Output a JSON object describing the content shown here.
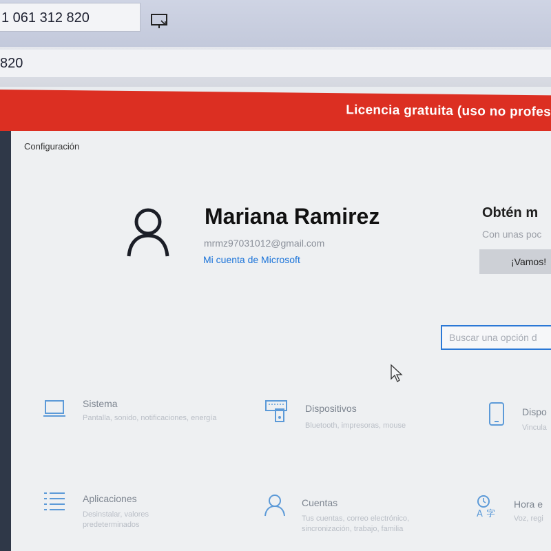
{
  "remote": {
    "id_value": "1 061 312 820",
    "address_value": "820"
  },
  "banner": {
    "text": "Licencia gratuita (uso no profes"
  },
  "settings": {
    "window_title": "Configuración",
    "user": {
      "name": "Mariana Ramirez",
      "email": "mrmz97031012@gmail.com",
      "account_link": "Mi cuenta de Microsoft"
    },
    "promo": {
      "title": "Obtén m",
      "subtitle": "Con unas poc",
      "button": "¡Vamos!"
    },
    "search": {
      "placeholder": "Buscar una opción d"
    },
    "categories": [
      {
        "title": "Sistema",
        "desc": "Pantalla, sonido, notificaciones, energía",
        "icon": "laptop-icon"
      },
      {
        "title": "Dispositivos",
        "desc": "Bluetooth, impresoras, mouse",
        "icon": "devices-icon"
      },
      {
        "title": "Dispo",
        "desc": "Vincula",
        "icon": "phone-icon"
      },
      {
        "title": "Aplicaciones",
        "desc": "Desinstalar, valores predeterminados",
        "icon": "apps-list-icon"
      },
      {
        "title": "Cuentas",
        "desc": "Tus cuentas, correo electrónico, sincronización, trabajo, familia",
        "icon": "person-icon"
      },
      {
        "title": "Hora e",
        "desc": "Voz, regi",
        "icon": "time-language-icon"
      }
    ]
  },
  "colors": {
    "banner_red": "#dc2f22",
    "accent_blue": "#2a78d6",
    "link_blue": "#1a73d9"
  }
}
